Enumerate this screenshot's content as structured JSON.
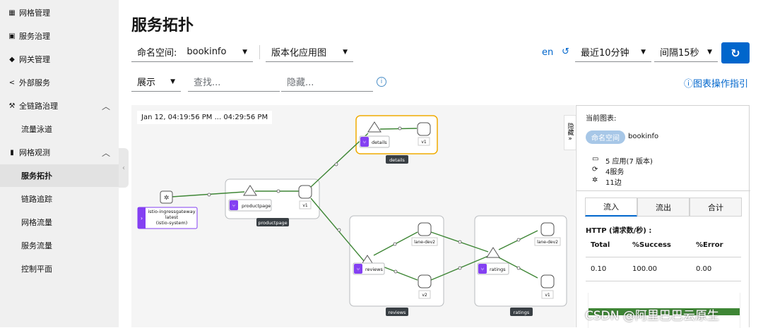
{
  "sidebar": {
    "items": [
      {
        "icon": "grid-icon",
        "glyph": "▦",
        "label": "网格管理"
      },
      {
        "icon": "service-icon",
        "glyph": "▣",
        "label": "服务治理"
      },
      {
        "icon": "gateway-icon",
        "glyph": "◆",
        "label": "网关管理"
      },
      {
        "icon": "share-icon",
        "glyph": "<",
        "label": "外部服务"
      },
      {
        "icon": "trace-icon",
        "glyph": "⚒",
        "label": "全链路治理"
      },
      {
        "label": "流量泳道"
      },
      {
        "icon": "chart-icon",
        "glyph": "▮",
        "label": "网格观测"
      },
      {
        "label": "服务拓扑"
      },
      {
        "label": "链路追踪"
      },
      {
        "label": "网格流量"
      },
      {
        "label": "服务流量"
      },
      {
        "label": "控制平面"
      }
    ]
  },
  "page": {
    "title": "服务拓扑",
    "namespace_label": "命名空间:",
    "namespace_value": "bookinfo",
    "graph_type": "版本化应用图",
    "lang": "en",
    "time_range": "最近10分钟",
    "interval": "间隔15秒",
    "display": "展示",
    "find_placeholder": "查找...",
    "hide_placeholder": "隐藏...",
    "guide": "ⓘ图表操作指引"
  },
  "graph": {
    "timestamp": "Jan 12, 04:19:56 PM ... 04:29:56 PM",
    "hide_button": "隐藏",
    "nodes": {
      "gateway": "istio-ingressgateway",
      "gateway_latest": "latest",
      "gateway_ns": "(istio-system)",
      "productpage": "productpage",
      "productpage_v1": "v1",
      "productpage_box": "productpage",
      "details": "details",
      "details_v1": "v1",
      "details_box": "details",
      "reviews": "reviews",
      "reviews_lane": "lane-dev2",
      "reviews_v2": "v2",
      "reviews_box": "reviews",
      "ratings": "ratings",
      "ratings_lane": "lane-dev2",
      "ratings_v1": "v1",
      "ratings_box": "ratings"
    }
  },
  "panel": {
    "current_graph": "当前图表:",
    "ns_badge": "命名空间",
    "ns_value": "bookinfo",
    "apps": "5 应用(7 版本)",
    "services": "4服务",
    "edges": "11边",
    "tabs": [
      "流入",
      "流出",
      "合计"
    ],
    "http_title": "HTTP (请求数/秒) :",
    "headers": [
      "Total",
      "%Success",
      "%Error"
    ],
    "values": [
      "0.10",
      "100.00",
      "0.00"
    ],
    "success_ratio": 1.0
  },
  "watermark": "CSDN @阿里巴巴云原生",
  "colors": {
    "accent": "#0066cc",
    "edge": "#3e8635",
    "details_border": "#f0ab00",
    "node_badge": "#8440f2"
  }
}
